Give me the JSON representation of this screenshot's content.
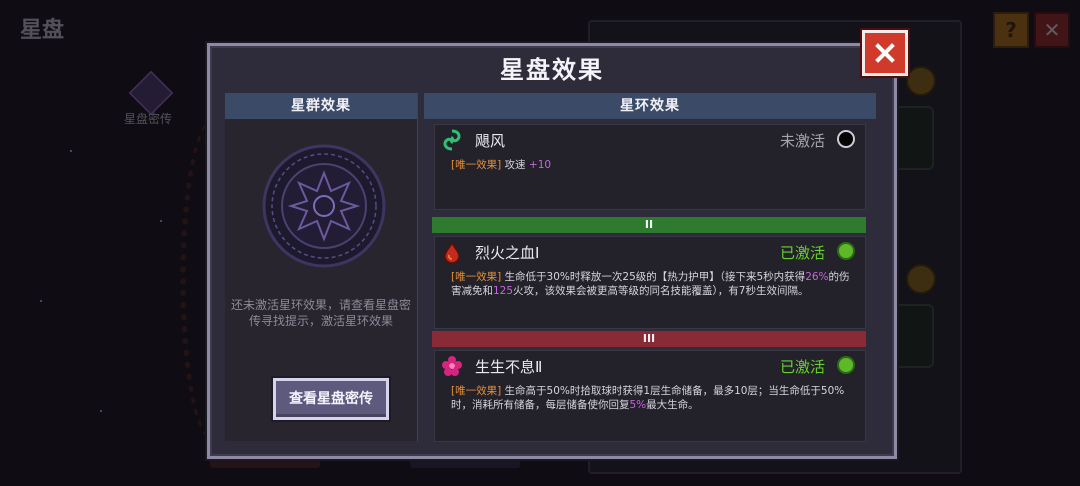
{
  "background": {
    "title": "星盘",
    "help_label": "?",
    "icon_label": "星盘密传"
  },
  "dialog": {
    "title": "星盘效果",
    "close_icon": "close-x-icon",
    "left": {
      "header": "星群效果",
      "tip": "还未激活星环效果，请查看星盘密传寻找提示，激活星环效果",
      "button": "查看星盘密传"
    },
    "right": {
      "header": "星环效果",
      "effects": [
        {
          "name": "飓风",
          "icon": "cyclone-icon",
          "status": "未激活",
          "status_color": "#a7a4b0",
          "dot_color": "#050505",
          "desc_tag": "[唯一效果]",
          "desc_parts": [
            "攻速 ",
            "+10"
          ]
        },
        {
          "tier": "II",
          "tier_color": "#2e7a2f",
          "name": "烈火之血Ⅰ",
          "icon": "blood-drop-icon",
          "status": "已激活",
          "status_color": "#66d22e",
          "dot_color": "#5fb82a",
          "desc_tag": "[唯一效果]",
          "desc_parts": [
            "生命低于30%时释放一次25级的【热力护甲】（接下来5秒内获得",
            "26%",
            "的伤害减免和",
            "125",
            "火攻，该效果会被更高等级的同名技能覆盖），有7秒生效间隔。"
          ]
        },
        {
          "tier": "III",
          "tier_color": "#8a2a37",
          "name": "生生不息Ⅱ",
          "icon": "flower-icon",
          "status": "已激活",
          "status_color": "#66d22e",
          "dot_color": "#5fb82a",
          "desc_tag": "[唯一效果]",
          "desc_parts": [
            "生命高于50%时拾取球时获得1层生命储备，最多10层；当生命低于50%时，消耗所有储备，每层储备使你回复",
            "5%",
            "最大生命。"
          ]
        }
      ]
    }
  }
}
